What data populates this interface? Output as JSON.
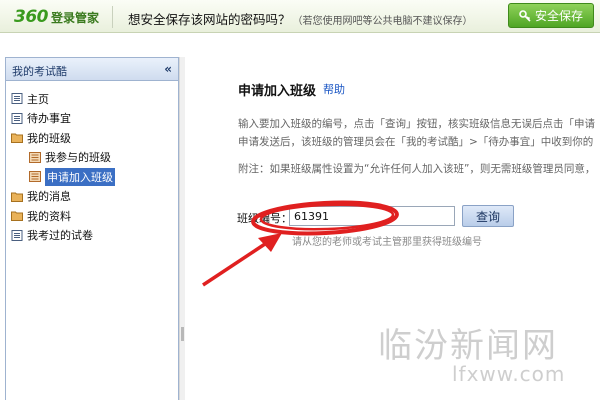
{
  "password_bar": {
    "brand_number": "360",
    "brand_name": "登录管家",
    "prompt": "想安全保存该网站的密码吗？",
    "prompt_note": "（若您使用网吧等公共电脑不建议保存）",
    "save_button": "安全保存",
    "save_icon": "key-icon",
    "colors": {
      "accent_green": "#4fa524",
      "link_blue": "#1a56c4",
      "annotation_red": "#e02020"
    }
  },
  "sidebar": {
    "title": "我的考试酷",
    "collapse_icon": "«",
    "items": [
      {
        "label": "主页",
        "level": 0,
        "icon": "page-icon"
      },
      {
        "label": "待办事宜",
        "level": 0,
        "icon": "page-icon"
      },
      {
        "label": "我的班级",
        "level": 0,
        "icon": "folder-icon"
      },
      {
        "label": "我参与的班级",
        "level": 1,
        "icon": "list-icon"
      },
      {
        "label": "申请加入班级",
        "level": 1,
        "icon": "list-icon",
        "selected": true
      },
      {
        "label": "我的消息",
        "level": 0,
        "icon": "folder-icon"
      },
      {
        "label": "我的资料",
        "level": 0,
        "icon": "folder-icon"
      },
      {
        "label": "我考过的试卷",
        "level": 0,
        "icon": "page-icon"
      }
    ]
  },
  "main": {
    "title": "申请加入班级",
    "help": "帮助",
    "description_line1": "输入要加入班级的编号，点击「查询」按钮，核实班级信息无误后点击「申请",
    "description_line2": "申请发送后，该班级的管理员会在「我的考试酷」>「待办事宜」中收到你的",
    "note": "附注：如果班级属性设置为“允许任何人加入该班”，则无需班级管理员同意，",
    "form_label": "班级编号：",
    "class_number": "61391",
    "search_button": "查询",
    "hint": "请从您的老师或考试主管那里获得班级编号"
  },
  "watermark": {
    "chinese": "临汾新闻网",
    "url": "lfxww.com"
  }
}
